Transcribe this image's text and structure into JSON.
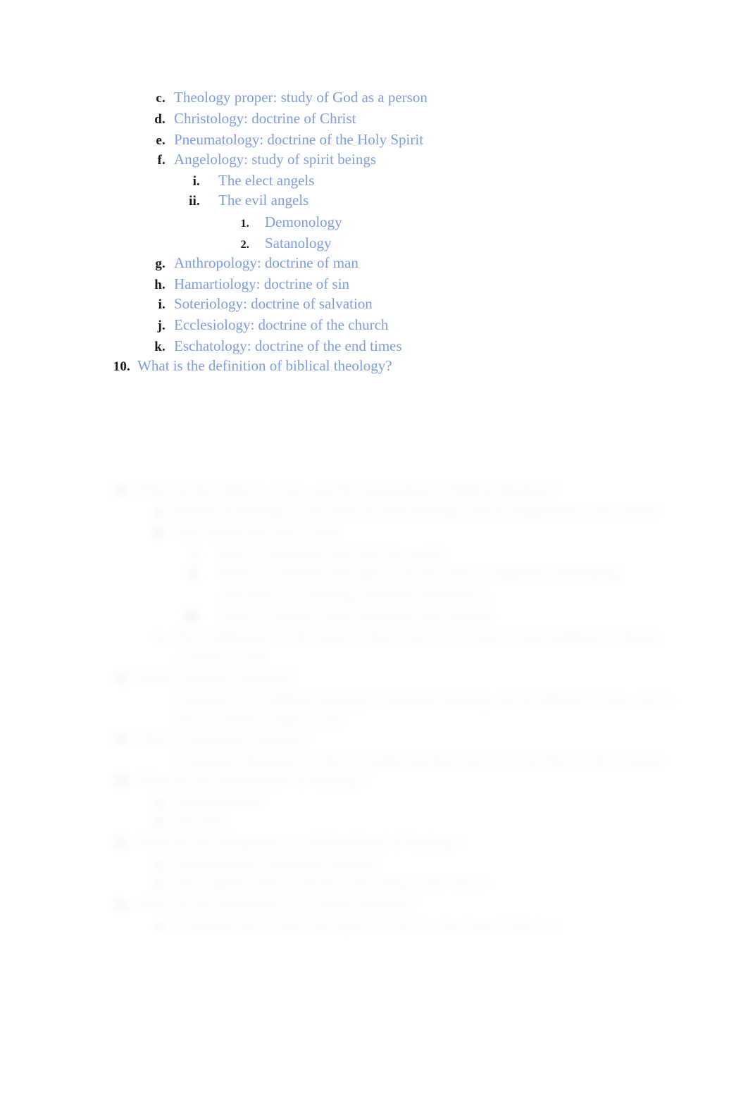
{
  "document": {
    "type": "outline-study-guide",
    "background_color": "#ffffff",
    "text_color": "#7b9fdc",
    "marker_color": "#1a1a1a"
  },
  "visible_outline": {
    "items": [
      {
        "marker": "c.",
        "level": 2,
        "text": "Theology proper: study of God as a person"
      },
      {
        "marker": "d.",
        "level": 2,
        "text": "Christology: doctrine of Christ"
      },
      {
        "marker": "e.",
        "level": 2,
        "text": "Pneumatology: doctrine of the Holy Spirit"
      },
      {
        "marker": "f.",
        "level": 2,
        "text": "Angelology: study of spirit beings"
      },
      {
        "marker": "i.",
        "level": 3,
        "text": "The elect angels"
      },
      {
        "marker": "ii.",
        "level": 3,
        "text": "The evil angels"
      },
      {
        "marker": "1.",
        "level": 4,
        "text": "Demonology"
      },
      {
        "marker": "2.",
        "level": 4,
        "text": "Satanology"
      },
      {
        "marker": "g.",
        "level": 2,
        "text": "Anthropology: doctrine of man"
      },
      {
        "marker": "h.",
        "level": 2,
        "text": "Hamartiology: doctrine of sin"
      },
      {
        "marker": "i.",
        "level": 2,
        "text": "Soteriology: doctrine of salvation"
      },
      {
        "marker": "j.",
        "level": 2,
        "text": "Ecclesiology: doctrine of the church"
      },
      {
        "marker": "k.",
        "level": 2,
        "text": "Eschatology: doctrine of the end times"
      },
      {
        "marker": "10.",
        "level": 1,
        "text": "What is the definition of biblical theology?"
      }
    ]
  },
  "obscured_outline": {
    "note": "Lower portion of the page is rendered blurred and faded; wording is not legible in the screenshot.",
    "items": [
      {
        "marker": "11.",
        "level": 1,
        "length": "long",
        "text": ""
      },
      {
        "marker": "a.",
        "level": 2,
        "length": "very-long",
        "text": ""
      },
      {
        "marker": "b.",
        "level": 2,
        "length": "short",
        "text": ""
      },
      {
        "marker": "i.",
        "level": 3,
        "length": "medium",
        "text": ""
      },
      {
        "marker": "ii.",
        "level": 3,
        "length": "long",
        "text": ""
      },
      {
        "marker": "",
        "level": 3,
        "length": "medium",
        "text": ""
      },
      {
        "marker": "iii.",
        "level": 3,
        "length": "medium",
        "text": ""
      },
      {
        "marker": "c.",
        "level": 2,
        "length": "very-long",
        "text": ""
      },
      {
        "marker": "",
        "level": 2,
        "length": "short",
        "text": ""
      },
      {
        "marker": "12.",
        "level": 1,
        "length": "short",
        "text": ""
      },
      {
        "marker": "",
        "level": 2,
        "length": "very-long",
        "text": ""
      },
      {
        "marker": "",
        "level": 2,
        "length": "medium",
        "text": ""
      },
      {
        "marker": "13.",
        "level": 1,
        "length": "short",
        "text": ""
      },
      {
        "marker": "",
        "level": 2,
        "length": "long",
        "text": ""
      },
      {
        "marker": "14.",
        "level": 1,
        "length": "medium",
        "text": ""
      },
      {
        "marker": "a.",
        "level": 2,
        "length": "short",
        "text": ""
      },
      {
        "marker": "b.",
        "level": 2,
        "length": "very-short",
        "text": ""
      },
      {
        "marker": "15.",
        "level": 1,
        "length": "long",
        "text": ""
      },
      {
        "marker": "a.",
        "level": 2,
        "length": "medium",
        "text": ""
      },
      {
        "marker": "b.",
        "level": 2,
        "length": "long",
        "text": ""
      },
      {
        "marker": "16.",
        "level": 1,
        "length": "medium",
        "text": ""
      },
      {
        "marker": "a.",
        "level": 2,
        "length": "long",
        "text": ""
      }
    ]
  }
}
